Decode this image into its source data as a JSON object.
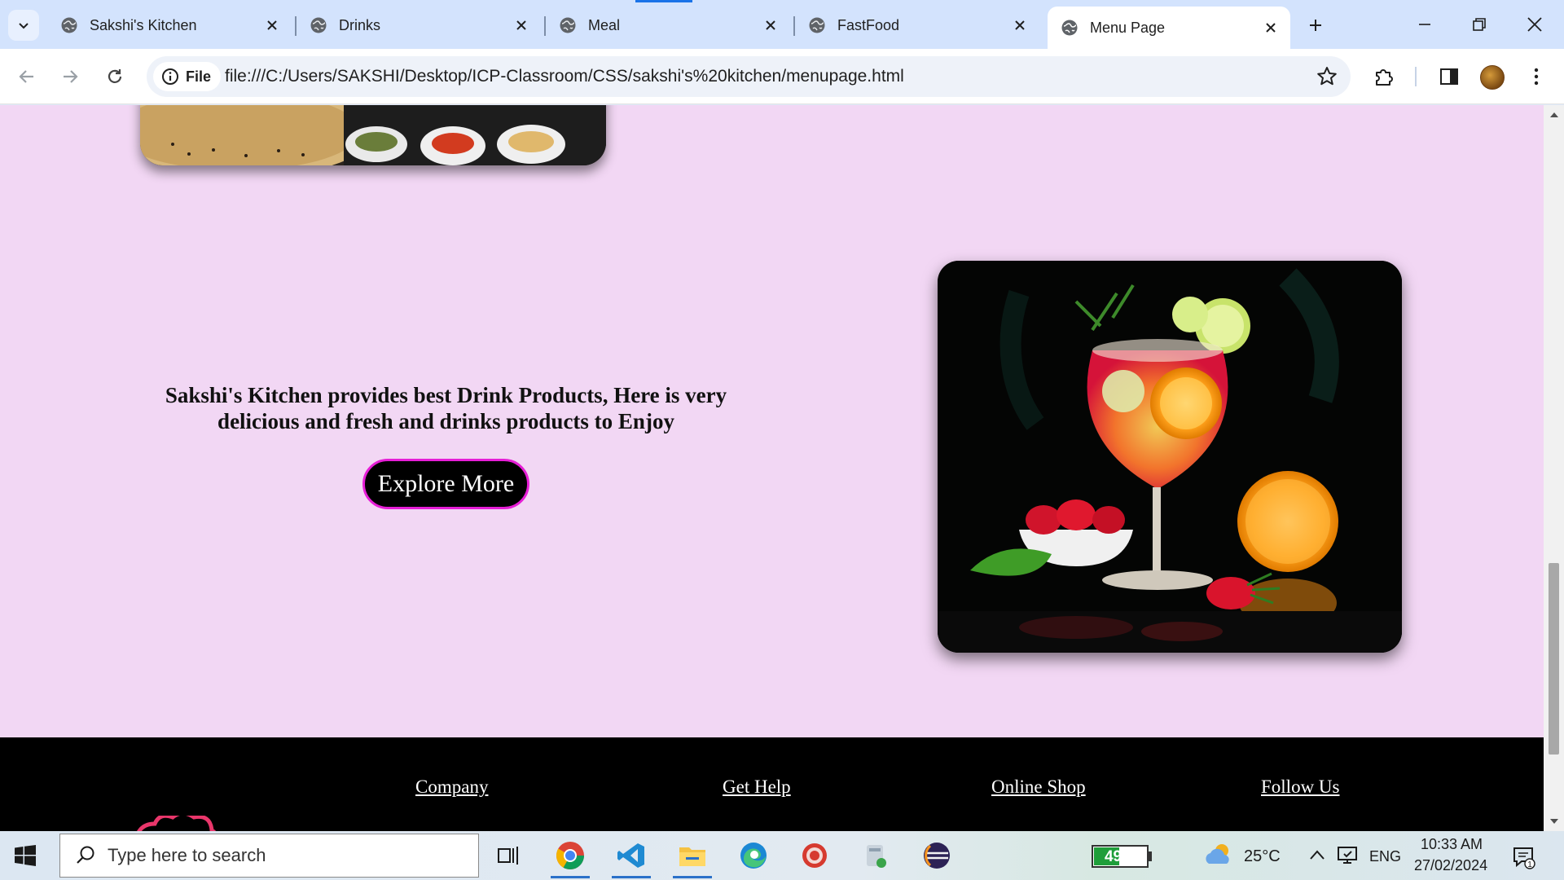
{
  "browser": {
    "tabs": [
      {
        "label": "Sakshi's Kitchen",
        "active": false
      },
      {
        "label": "Drinks",
        "active": false
      },
      {
        "label": "Meal",
        "active": false
      },
      {
        "label": "FastFood",
        "active": false
      },
      {
        "label": "Menu Page",
        "active": true
      }
    ],
    "address": {
      "chip_label": "File",
      "url": "file:///C:/Users/SAKSHI/Desktop/ICP-Classroom/CSS/sakshi's%20kitchen/menupage.html"
    }
  },
  "page": {
    "promo_text": "Sakshi's Kitchen provides best Drink Products, Here is very delicious and fresh and drinks products to Enjoy",
    "explore_button": "Explore More",
    "footer": {
      "links": [
        "Company",
        "Get Help",
        "Online Shop",
        "Follow Us"
      ]
    },
    "colors": {
      "page_background": "#f2d7f4",
      "button_border": "#e61ed6",
      "footer_background": "#000000"
    }
  },
  "taskbar": {
    "search_placeholder": "Type here to search",
    "battery": {
      "label": "49%",
      "level": 0.49
    },
    "weather": "25°C",
    "language": "ENG",
    "time": "10:33 AM",
    "date": "27/02/2024",
    "notification_count": "1"
  }
}
